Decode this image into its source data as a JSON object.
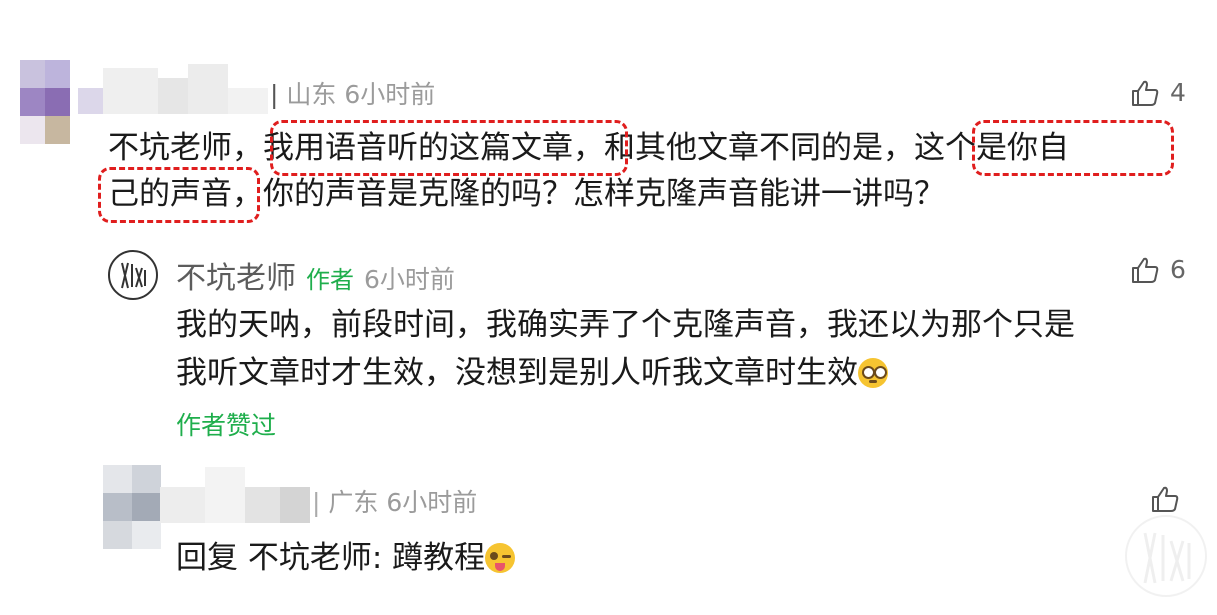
{
  "comment1": {
    "location_time": "山东 6小时前",
    "likes": "4",
    "body": {
      "line1_pre": "不坑老师，",
      "line1_hl1": "我用语音听的这篇文章",
      "line1_mid": "，和其他文章不同的是，",
      "line1_hl2": "这个是你自",
      "line2_hl": "己的声音",
      "line2_post": "，你的声音是克隆的吗？怎样克隆声音能讲一讲吗？"
    }
  },
  "reply1": {
    "author_name": "不坑老师",
    "author_tag": "作者",
    "time": "6小时前",
    "likes": "6",
    "line1": "我的天呐，前段时间，我确实弄了个克隆声音，我还以为那个只是",
    "line2": "我听文章时才生效，没想到是别人听我文章时生效",
    "emoji": "flushed-face",
    "author_liked": "作者赞过"
  },
  "reply2": {
    "location_time": "广东 6小时前",
    "body": "回复 不坑老师: 蹲教程",
    "emoji": "winking-tongue-face"
  },
  "colors": {
    "accent_green": "#1fae4c",
    "highlight_red": "#e01e1e",
    "meta_gray": "#9b9b9b"
  }
}
